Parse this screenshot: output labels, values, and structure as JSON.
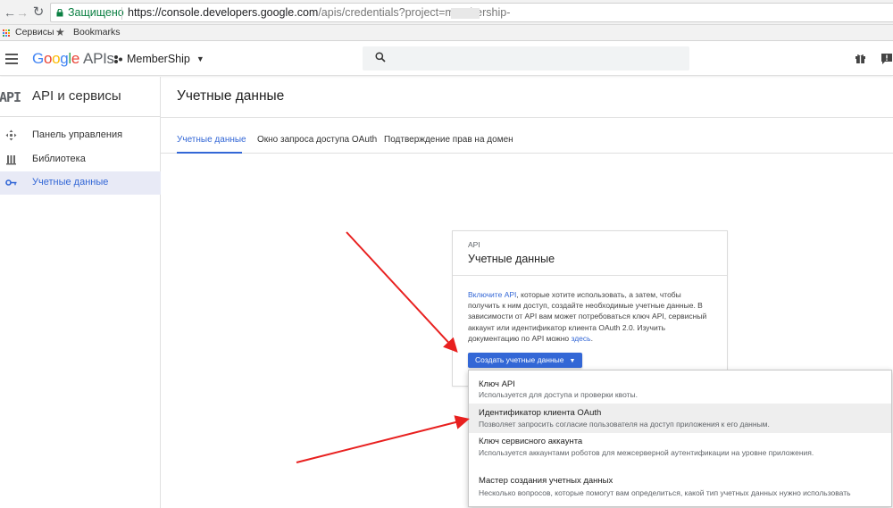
{
  "browser": {
    "secure_label": "Защищено",
    "url_main": "https://console.developers.google.com",
    "url_rest": "/apis/credentials?project=membership-",
    "bookmarks": {
      "services": "Сервисы",
      "bookmarks": "Bookmarks"
    }
  },
  "header": {
    "logo_letters": [
      "G",
      "o",
      "o",
      "g",
      "l",
      "e"
    ],
    "logo_suffix": "APIs",
    "project": "MemberShip"
  },
  "sidebar": {
    "badge": "API",
    "title": "API и сервисы",
    "items": [
      {
        "label": "Панель управления",
        "icon": "dashboard-icon"
      },
      {
        "label": "Библиотека",
        "icon": "library-icon"
      },
      {
        "label": "Учетные данные",
        "icon": "key-icon"
      }
    ]
  },
  "main": {
    "title": "Учетные данные",
    "tabs": [
      {
        "label": "Учетные данные"
      },
      {
        "label": "Окно запроса доступа OAuth"
      },
      {
        "label": "Подтверждение прав на домен"
      }
    ]
  },
  "card": {
    "kicker": "API",
    "title": "Учетные данные",
    "link_enable": "Включите API",
    "body_text": ", которые хотите использовать, а затем, чтобы получить к ним доступ, создайте необходимые учетные данные. В зависимости от API вам может потребоваться ключ API, сервисный аккаунт или идентификатор клиента OAuth 2.0. Изучить документацию по API можно ",
    "link_here": "здесь",
    "body_end": ".",
    "button_label": "Создать учетные данные"
  },
  "dropdown": {
    "items": [
      {
        "title": "Ключ API",
        "desc": "Используется для доступа и проверки квоты."
      },
      {
        "title": "Идентификатор клиента OAuth",
        "desc": "Позволяет запросить согласие пользователя на доступ приложения к его данным."
      },
      {
        "title": "Ключ сервисного аккаунта",
        "desc": "Используется аккаунтами роботов для межсерверной аутентификации на уровне приложения."
      },
      {
        "title": "Мастер создания учетных данных",
        "desc": "Несколько вопросов, которые помогут вам определиться, какой тип учетных данных нужно использовать"
      }
    ]
  },
  "colors": {
    "accent": "#3367d6",
    "annotation_arrow": "#e8201f",
    "secure_green": "#0b8043"
  }
}
